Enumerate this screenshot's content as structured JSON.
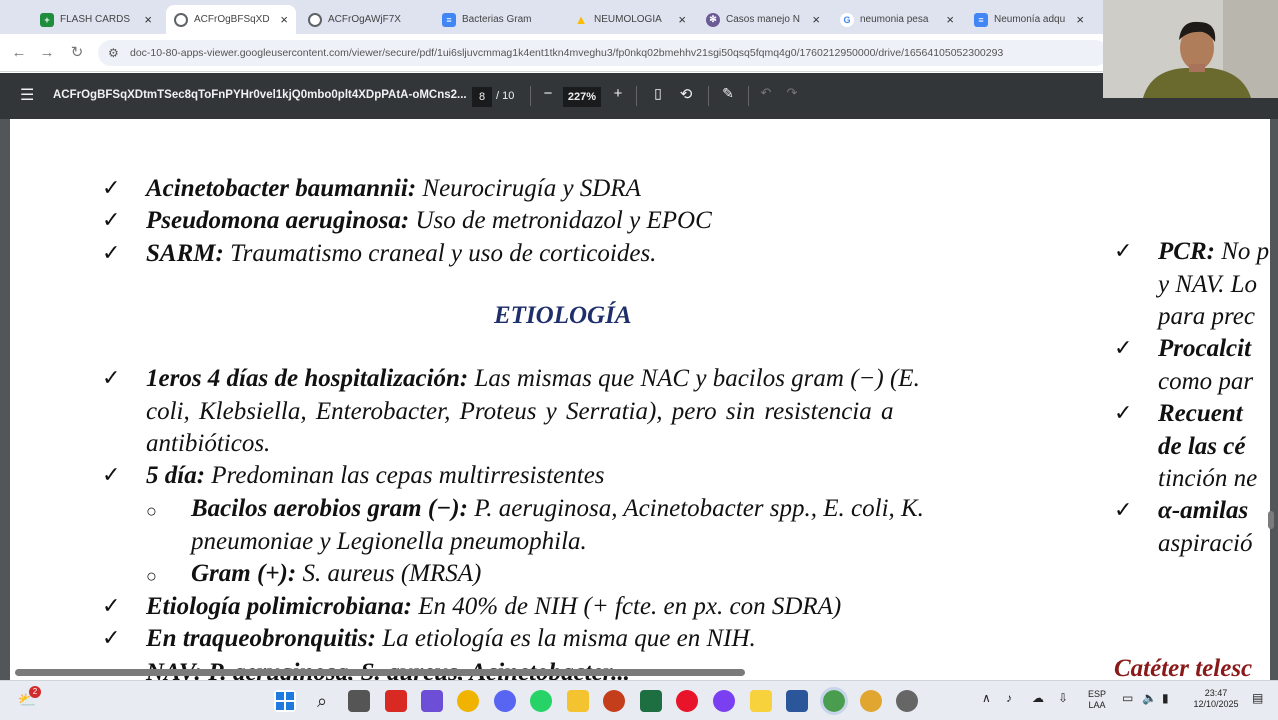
{
  "tabs": [
    {
      "title": "FLASH CARDS",
      "favicon": "sheets-icon",
      "color": "#1e8e3e",
      "active": false
    },
    {
      "title": "ACFrOgBFSqXD",
      "favicon": "chrome-icon",
      "color": "#5f6368",
      "active": true
    },
    {
      "title": "ACFrOgAWjF7X",
      "favicon": "chrome-icon",
      "color": "#5f6368",
      "active": false
    },
    {
      "title": "Bacterias Gram",
      "favicon": "docs-icon",
      "color": "#4285f4",
      "active": false
    },
    {
      "title": "NEUMOLOGÍA",
      "favicon": "drive-icon",
      "color": "#fbbc04",
      "active": false
    },
    {
      "title": "Casos manejo N",
      "favicon": "gear-icon",
      "color": "#6b5b95",
      "active": false
    },
    {
      "title": "neumonia pesa",
      "favicon": "google-icon",
      "color": "#ea4335",
      "active": false
    },
    {
      "title": "Neumonía adqu",
      "favicon": "docs-icon",
      "color": "#4285f4",
      "active": false
    }
  ],
  "address": {
    "url": "doc-10-80-apps-viewer.googleusercontent.com/viewer/secure/pdf/1ui6sljuvcmmag1k4ent1tkn4mveghu3/fp0nkq02bmehhv21sgi50qsq5fqmq4g0/1760212950000/drive/16564105052300293"
  },
  "pdf_toolbar": {
    "filename": "ACFrOgBFSqXDtmTSec8qToFnPYHr0vel1kjQ0mbo0plt4XDpPAtA-oMCns2...",
    "current_page": "8",
    "total_pages": "/ 10",
    "zoom": "227%",
    "minus": "−",
    "plus": "+"
  },
  "document": {
    "risk_items": [
      {
        "bold": "Acinetobacter baumannii:",
        "text": " Neurocirugía y SDRA"
      },
      {
        "bold": "Pseudomona aeruginosa:",
        "text": " Uso de metronidazol y EPOC"
      },
      {
        "bold": "SARM:",
        "text": " Traumatismo craneal y uso de corticoides."
      }
    ],
    "heading": "ETIOLOGÍA",
    "etio": {
      "first_bold": "1eros 4 días de hospitalización:",
      "first_text_l1": " Las mismas que NAC y bacilos gram (−) (E.",
      "first_text_l2": "coli, Klebsiella, Enterobacter, Proteus y Serratia), pero sin resistencia a",
      "first_text_l3": "antibióticos.",
      "fifth_bold": "5 día:",
      "fifth_text": " Predominan las cepas multirresistentes",
      "sub1_bold": "Bacilos aerobios gram (−):",
      "sub1_text_l1": "  P. aeruginosa, Acinetobacter spp., E. coli, K.",
      "sub1_text_l2": "pneumoniae y Legionella pneumophila.",
      "sub2_bold": "Gram (+):",
      "sub2_text": " S. aureus (MRSA)",
      "poly_bold": "Etiología polimicrobiana:",
      "poly_text": " En 40% de NIH (+ fcte. en px. con SDRA)",
      "traq_bold": "En traqueobronquitis:",
      "traq_text": " La etiología es la misma que en NIH.",
      "nav_cut": "NAV: P. aeruginosa, S. aureus, Acinetobacter..."
    },
    "right_column": {
      "pcr_bold": "PCR:",
      "pcr_text": " No p",
      "pcr_l2": "y NAV. Lo",
      "pcr_l3": "para prec",
      "procal_bold": "Procalcit",
      "procal_l2": "como par",
      "recuento_bold": "Recuent",
      "recuento_l2": "de las cé",
      "recuento_l3": "tinción ne",
      "amilasa_bold": "α-amilas",
      "amilasa_l2": "aspiració",
      "cateter": "Catéter telesc"
    },
    "check": "✓",
    "circle": "○"
  },
  "taskbar": {
    "notif_badge": "2",
    "lang": "ESP",
    "layout": "LAA",
    "time": "23:47",
    "date": "12/10/2025"
  }
}
